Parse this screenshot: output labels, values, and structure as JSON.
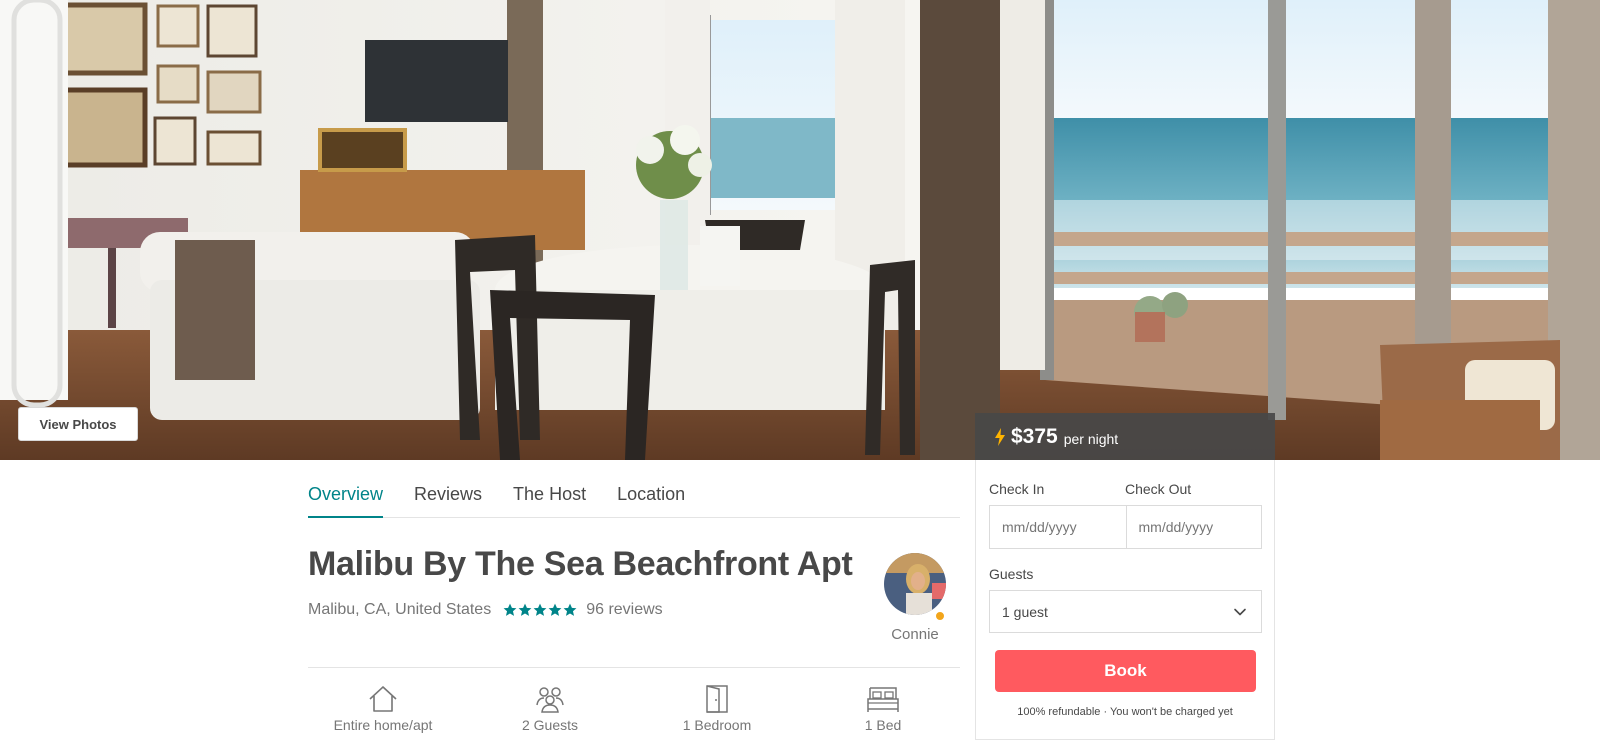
{
  "hero": {
    "view_photos_label": "View Photos",
    "price": "$375",
    "per_night": "per night",
    "lightning_color": "#ffb400"
  },
  "tabs": [
    {
      "label": "Overview",
      "active": true
    },
    {
      "label": "Reviews",
      "active": false
    },
    {
      "label": "The Host",
      "active": false
    },
    {
      "label": "Location",
      "active": false
    }
  ],
  "listing": {
    "title": "Malibu By The Sea Beachfront Apt",
    "location": "Malibu, CA, United States",
    "rating_stars": 5,
    "reviews": "96 reviews",
    "host_name": "Connie"
  },
  "amenities": [
    {
      "icon": "home-icon",
      "label": "Entire home/apt"
    },
    {
      "icon": "guests-icon",
      "label": "2 Guests"
    },
    {
      "icon": "door-icon",
      "label": "1 Bedroom"
    },
    {
      "icon": "bed-icon",
      "label": "1 Bed"
    }
  ],
  "booking": {
    "check_in_label": "Check In",
    "check_out_label": "Check Out",
    "check_in_placeholder": "mm/dd/yyyy",
    "check_out_placeholder": "mm/dd/yyyy",
    "guests_label": "Guests",
    "guests_value": "1 guest",
    "book_label": "Book",
    "refund_note": "100% refundable · You won't be charged yet"
  },
  "colors": {
    "accent": "#008489",
    "book_button": "#ff5a5f",
    "text": "#484848",
    "muted": "#767676",
    "superhost": "#f2a51b"
  }
}
